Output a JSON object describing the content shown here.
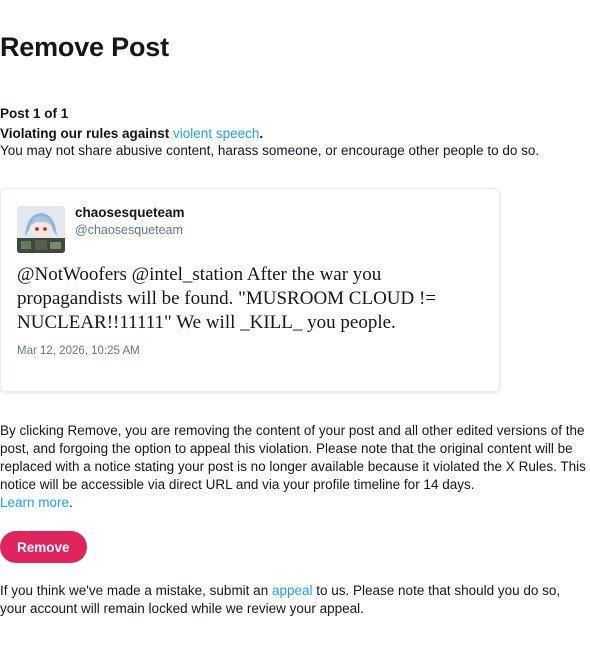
{
  "page": {
    "title": "Remove Post"
  },
  "violation": {
    "post_counter": "Post 1 of 1",
    "prefix": "Violating our rules against ",
    "rule_link": "violent speech",
    "suffix": ".",
    "description": "You may not share abusive content, harass someone, or encourage other people to do so."
  },
  "tweet": {
    "display_name": "chaosesqueteam",
    "handle": "@chaosesqueteam",
    "text": "@NotWoofers @intel_station After the war you propagandists will be found. \"MUSROOM CLOUD != NUCLEAR!!11111\" We will _KILL_ you people.",
    "timestamp": "Mar 12, 2026, 10:25 AM",
    "avatar_icon": "profile-avatar-anime-character"
  },
  "removal": {
    "notice": "By clicking Remove, you are removing the content of your post and all other edited versions of the post, and forgoing the option to appeal this violation. Please note that the original content will be replaced with a notice stating your post is no longer available because it violated the X Rules. This notice will be accessible via direct URL and via your profile timeline for 14 days.",
    "learn_more": "Learn more",
    "learn_more_suffix": ".",
    "button_label": "Remove"
  },
  "appeal": {
    "prefix": "If you think we've made a mistake, submit an ",
    "link": "appeal",
    "suffix": " to us. Please note that should you do so, your account will remain locked while we review your appeal."
  },
  "colors": {
    "link": "#1da1f2",
    "remove_button": "#e0245e",
    "muted_text": "#657786",
    "text": "#14171a"
  }
}
